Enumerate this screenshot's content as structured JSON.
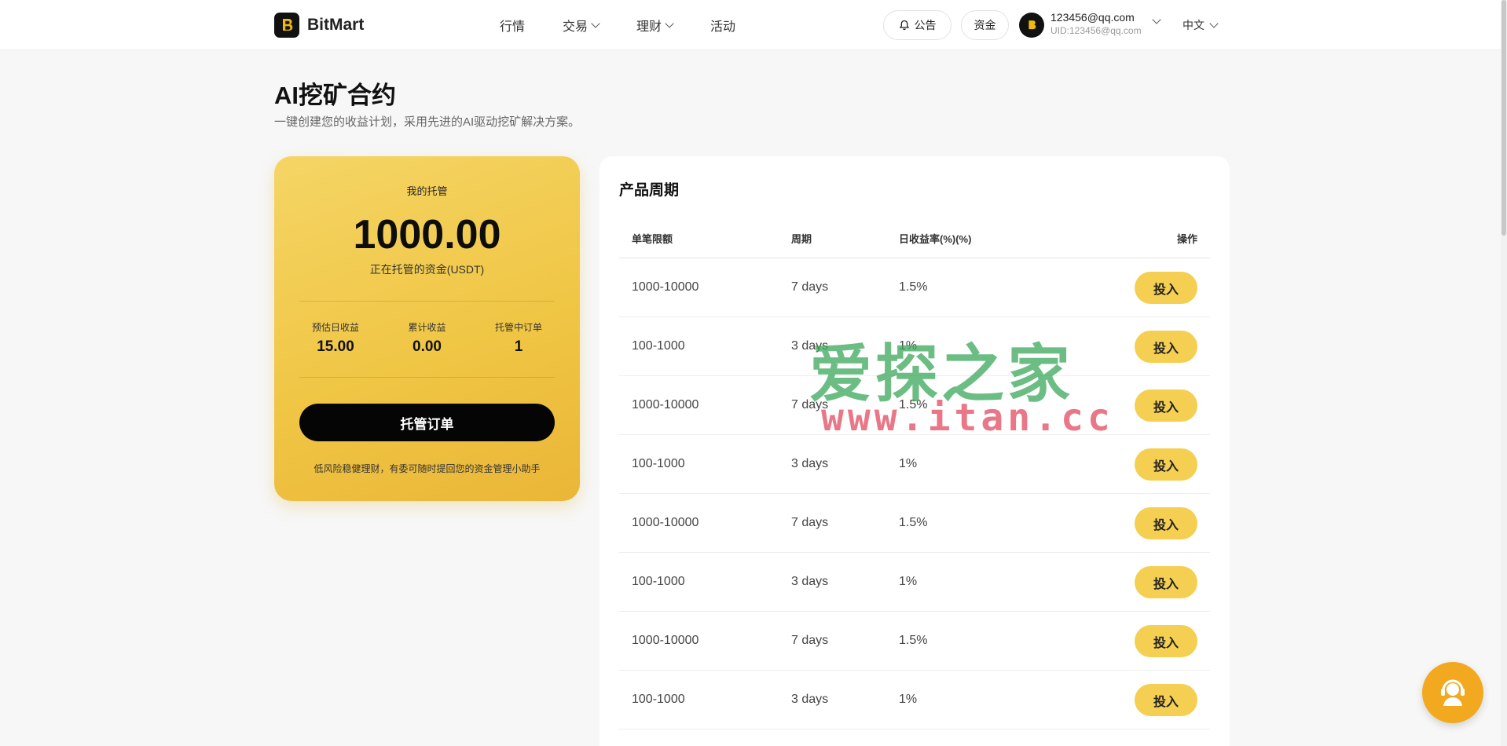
{
  "header": {
    "brand": "BitMart",
    "nav": [
      {
        "label": "行情",
        "has_dropdown": false
      },
      {
        "label": "交易",
        "has_dropdown": true
      },
      {
        "label": "理财",
        "has_dropdown": true
      },
      {
        "label": "活动",
        "has_dropdown": false
      }
    ],
    "notice_label": "公告",
    "funds_label": "资金",
    "user_email": "123456@qq.com",
    "user_uid": "UID:123456@qq.com",
    "language": "中文"
  },
  "page": {
    "title": "AI挖矿合约",
    "subtitle": "一键创建您的收益计划，采用先进的AI驱动挖矿解决方案。"
  },
  "custody_card": {
    "label": "我的托管",
    "amount": "1000.00",
    "caption": "正在托管的资金(USDT)",
    "stats": [
      {
        "label": "预估日收益",
        "value": "15.00"
      },
      {
        "label": "累计收益",
        "value": "0.00"
      },
      {
        "label": "托管中订单",
        "value": "1"
      }
    ],
    "cta_label": "托管订单",
    "note": "低风险稳健理财，有委可随时提回您的资金管理小助手"
  },
  "products": {
    "title": "产品周期",
    "columns": [
      "单笔限额",
      "周期",
      "日收益率(%)(%)",
      "操作"
    ],
    "rows": [
      {
        "limit": "1000-10000",
        "period": "7 days",
        "rate": "1.5%",
        "action": "投入"
      },
      {
        "limit": "100-1000",
        "period": "3 days",
        "rate": "1%",
        "action": "投入"
      },
      {
        "limit": "1000-10000",
        "period": "7 days",
        "rate": "1.5%",
        "action": "投入"
      },
      {
        "limit": "100-1000",
        "period": "3 days",
        "rate": "1%",
        "action": "投入"
      },
      {
        "limit": "1000-10000",
        "period": "7 days",
        "rate": "1.5%",
        "action": "投入"
      },
      {
        "limit": "100-1000",
        "period": "3 days",
        "rate": "1%",
        "action": "投入"
      },
      {
        "limit": "1000-10000",
        "period": "7 days",
        "rate": "1.5%",
        "action": "投入"
      },
      {
        "limit": "100-1000",
        "period": "3 days",
        "rate": "1%",
        "action": "投入"
      }
    ]
  },
  "watermark": {
    "cn": "爱探之家",
    "url": "www.itan.cc"
  },
  "colors": {
    "accent": "#f5cf52",
    "card_gold": "#f0c645",
    "support": "#f2a91f",
    "watermark_green": "#3aa85a",
    "watermark_red": "#e24a60"
  },
  "icons": {
    "brand": "bitmart-logo-icon",
    "notice": "bell-icon",
    "support": "customer-service-icon"
  }
}
